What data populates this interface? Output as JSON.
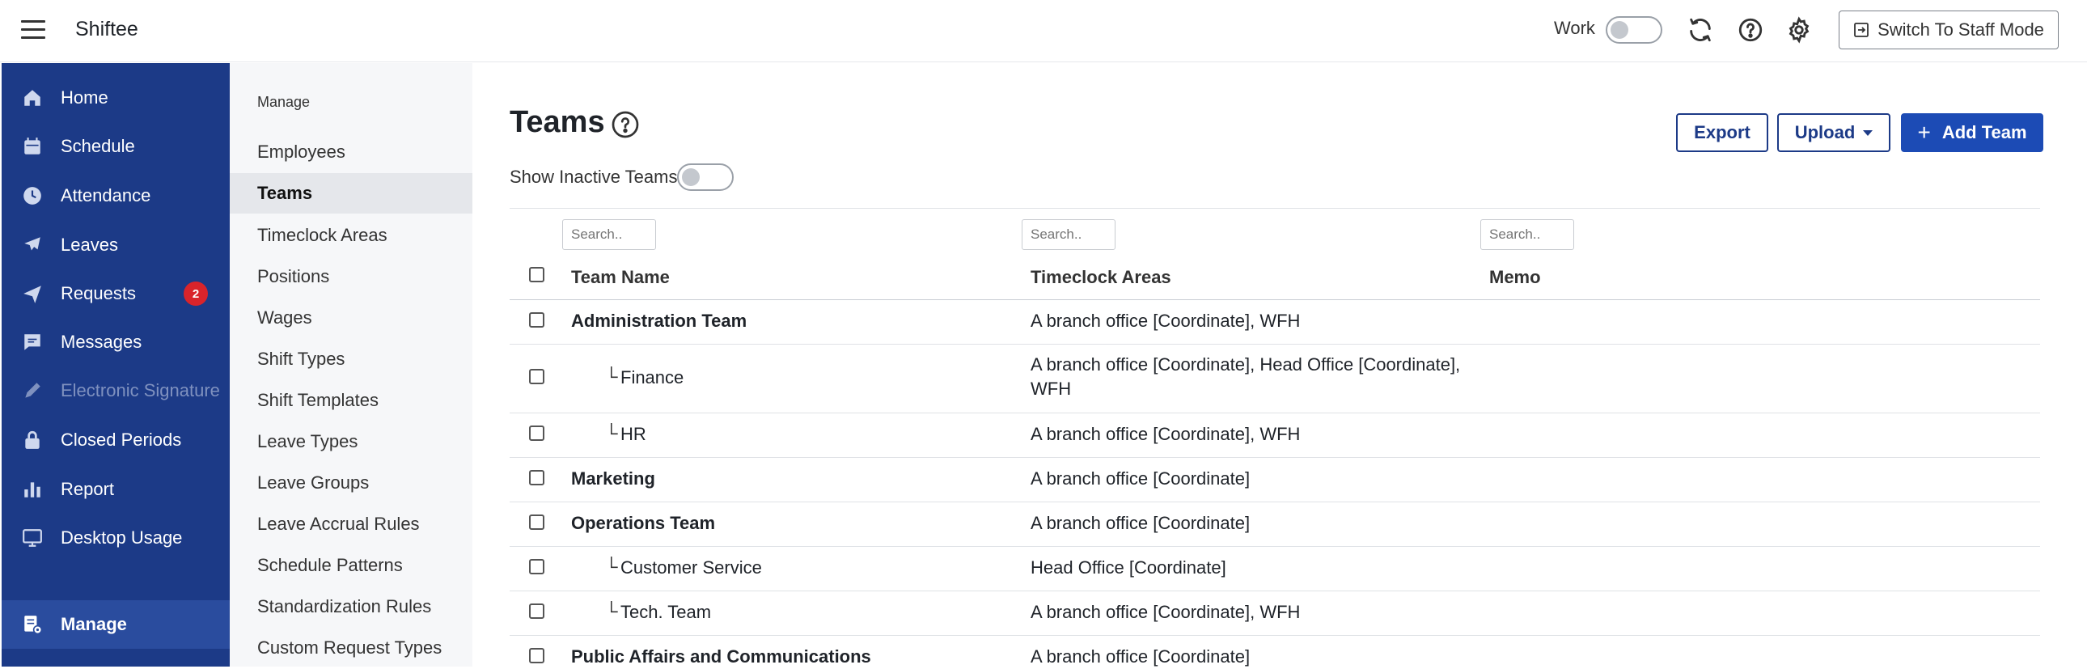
{
  "app": {
    "title": "Shiftee"
  },
  "topbar": {
    "work_label": "Work",
    "switch_label": "Switch To Staff Mode",
    "icons": [
      "refresh-icon",
      "help-icon",
      "gear-icon"
    ]
  },
  "sidebar": {
    "items": [
      {
        "label": "Home",
        "icon": "home-icon"
      },
      {
        "label": "Schedule",
        "icon": "calendar-icon"
      },
      {
        "label": "Attendance",
        "icon": "clock-icon"
      },
      {
        "label": "Leaves",
        "icon": "plane-icon"
      },
      {
        "label": "Requests",
        "icon": "send-icon",
        "badge": "2"
      },
      {
        "label": "Messages",
        "icon": "message-icon"
      },
      {
        "label": "Electronic Signature",
        "icon": "pen-icon",
        "disabled": true
      },
      {
        "label": "Closed Periods",
        "icon": "lock-icon"
      },
      {
        "label": "Report",
        "icon": "bar-chart-icon"
      },
      {
        "label": "Desktop Usage",
        "icon": "monitor-icon"
      },
      {
        "label": "Manage",
        "icon": "manage-icon",
        "active": true
      }
    ]
  },
  "subnav": {
    "heading": "Manage",
    "items": [
      "Employees",
      "Teams",
      "Timeclock Areas",
      "Positions",
      "Wages",
      "Shift Types",
      "Shift Templates",
      "Leave Types",
      "Leave Groups",
      "Leave Accrual Rules",
      "Schedule Patterns",
      "Standardization Rules",
      "Custom Request Types"
    ],
    "active": "Teams"
  },
  "page": {
    "title": "Teams",
    "show_inactive_label": "Show Inactive Teams",
    "export_label": "Export",
    "upload_label": "Upload",
    "add_label": "Add Team"
  },
  "table": {
    "search_placeholder": "Search..",
    "headers": [
      "Team Name",
      "Timeclock Areas",
      "Memo"
    ],
    "rows": [
      {
        "name": "Administration Team",
        "prefix": "",
        "areas": "A branch office [Coordinate], WFH",
        "memo": "",
        "level": 0
      },
      {
        "name": "Finance",
        "prefix": "└",
        "areas": "A branch office [Coordinate], Head Office [Coordinate],",
        "areas2": "WFH",
        "memo": "",
        "level": 1
      },
      {
        "name": "HR",
        "prefix": "└",
        "areas": "A branch office [Coordinate], WFH",
        "memo": "",
        "level": 1
      },
      {
        "name": "Marketing",
        "prefix": "",
        "areas": "A branch office [Coordinate]",
        "memo": "",
        "level": 0
      },
      {
        "name": "Operations Team",
        "prefix": "",
        "areas": "A branch office [Coordinate]",
        "memo": "",
        "level": 0
      },
      {
        "name": "Customer Service",
        "prefix": "└",
        "areas": "Head Office [Coordinate]",
        "memo": "",
        "level": 1
      },
      {
        "name": "Tech. Team",
        "prefix": "└",
        "areas": "A branch office [Coordinate], WFH",
        "memo": "",
        "level": 1
      },
      {
        "name": "Public Affairs and Communications",
        "prefix": "",
        "areas": "A branch office [Coordinate]",
        "memo": "",
        "level": 0
      }
    ]
  },
  "colors": {
    "sidebar": "#1c3a87",
    "primary": "#1c4bb5",
    "badge": "#d9242b"
  }
}
